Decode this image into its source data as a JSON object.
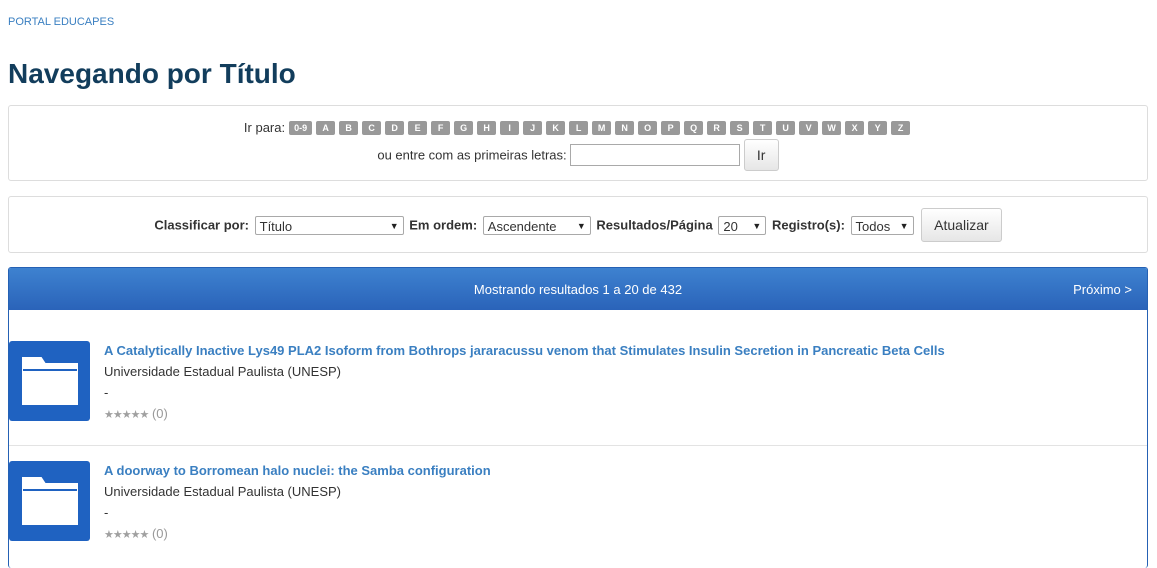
{
  "breadcrumb": "PORTAL EDUCAPES",
  "page_title": "Navegando por Título",
  "jump": {
    "label": "Ir para:",
    "letters": [
      "0-9",
      "A",
      "B",
      "C",
      "D",
      "E",
      "F",
      "G",
      "H",
      "I",
      "J",
      "K",
      "L",
      "M",
      "N",
      "O",
      "P",
      "Q",
      "R",
      "S",
      "T",
      "U",
      "V",
      "W",
      "X",
      "Y",
      "Z"
    ],
    "starts_label": "ou entre com as primeiras letras:",
    "starts_value": "",
    "go_button": "Ir"
  },
  "sort": {
    "sort_by_label": "Classificar por:",
    "sort_by_value": "Título",
    "order_label": "Em ordem:",
    "order_value": "Ascendente",
    "rpp_label": "Resultados/Página",
    "rpp_value": "20",
    "records_label": "Registro(s):",
    "records_value": "Todos",
    "update_button": "Atualizar"
  },
  "results": {
    "summary": "Mostrando resultados 1 a 20 de 432",
    "next_label": "Próximo >",
    "items": [
      {
        "title": "A Catalytically Inactive Lys49 PLA2 Isoform from Bothrops jararacussu venom that Stimulates Insulin Secretion in Pancreatic Beta Cells",
        "publisher": "Universidade Estadual Paulista (UNESP)",
        "dash": "-",
        "stars": "★★★★★",
        "rating": "(0)",
        "icon": "folder-icon"
      },
      {
        "title": "A doorway to Borromean halo nuclei: the Samba configuration",
        "publisher": "Universidade Estadual Paulista (UNESP)",
        "dash": "-",
        "stars": "★★★★★",
        "rating": "(0)",
        "icon": "folder-icon"
      }
    ]
  },
  "colors": {
    "title": "#123d5c",
    "link": "#3a7fc1",
    "header_blue": "#2a63b9",
    "thumb_blue": "#1f62c1",
    "letter_gray": "#999999"
  }
}
